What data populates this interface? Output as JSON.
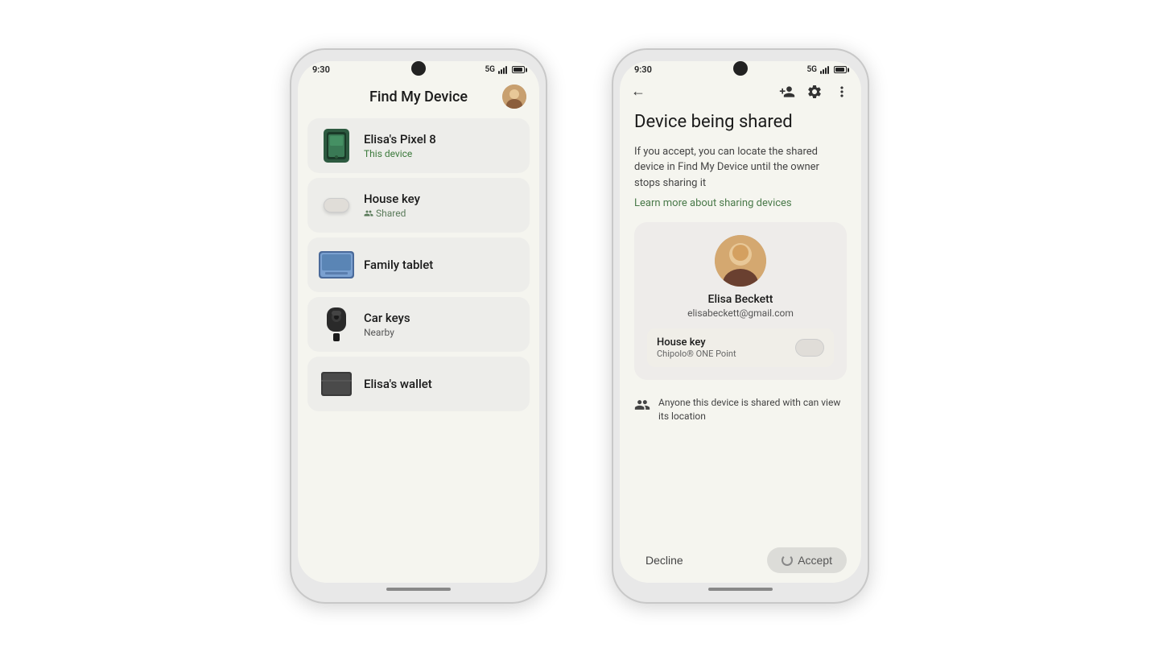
{
  "left_phone": {
    "status_time": "9:30",
    "status_5g": "5G",
    "title": "Find My Device",
    "devices": [
      {
        "name": "Elisa's Pixel 8",
        "status": "This device",
        "status_class": "this-device",
        "icon_type": "pixel8"
      },
      {
        "name": "House key",
        "status": "Shared",
        "status_class": "shared",
        "icon_type": "housekey"
      },
      {
        "name": "Family tablet",
        "status": "",
        "status_class": "",
        "icon_type": "tablet"
      },
      {
        "name": "Car keys",
        "status": "Nearby",
        "status_class": "nearby",
        "icon_type": "carkeys"
      },
      {
        "name": "Elisa's wallet",
        "status": "",
        "status_class": "",
        "icon_type": "wallet"
      }
    ]
  },
  "right_phone": {
    "status_time": "9:30",
    "status_5g": "5G",
    "title": "Device being shared",
    "description": "If you accept, you can locate the shared device in Find My Device until the owner stops sharing it",
    "learn_more": "Learn more about sharing devices",
    "sharer": {
      "name": "Elisa Beckett",
      "email": "elisabeckett@gmail.com"
    },
    "device": {
      "name": "House key",
      "type": "Chipolo® ONE Point"
    },
    "notice": "Anyone this device is shared with can view its location",
    "decline_label": "Decline",
    "accept_label": "Accept"
  }
}
